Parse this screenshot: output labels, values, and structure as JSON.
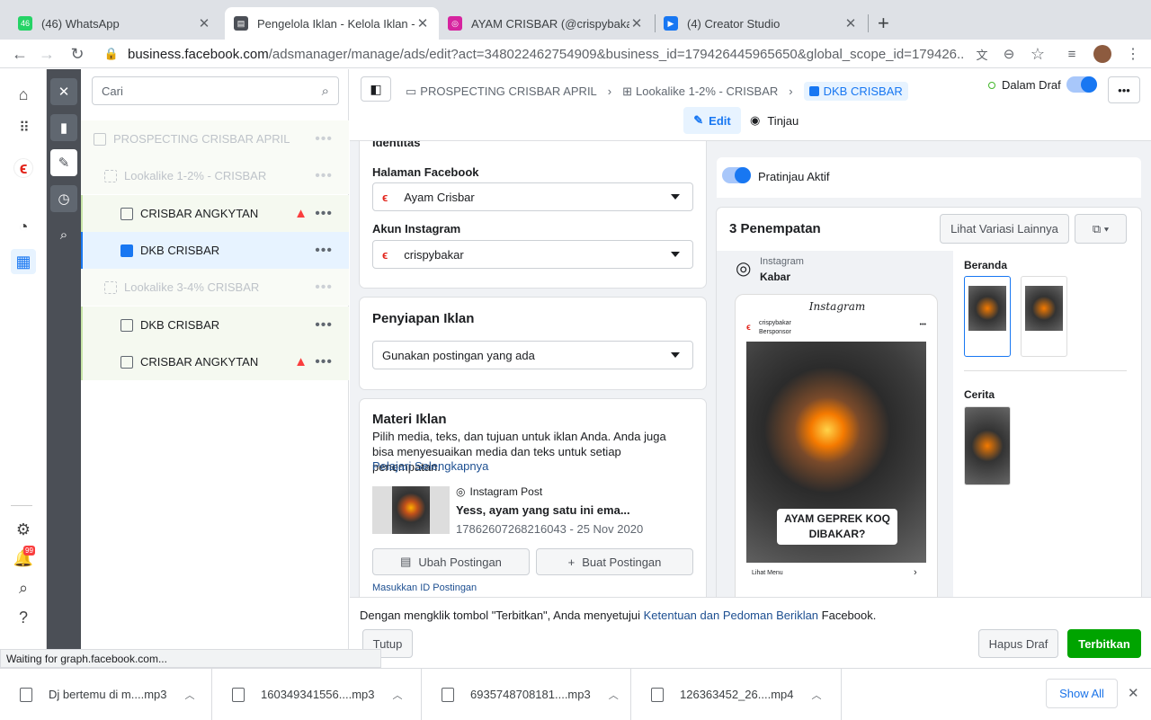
{
  "tabs": [
    {
      "title": "(46) WhatsApp",
      "badge": "46",
      "color": "#25d366"
    },
    {
      "title": "Pengelola Iklan - Kelola Iklan -",
      "color": "#4b4f56"
    },
    {
      "title": "AYAM CRISBAR (@crispybakar)",
      "color": "#d6249f"
    },
    {
      "title": "(4) Creator Studio",
      "color": "#1877f2"
    }
  ],
  "url": {
    "host": "business.facebook.com",
    "path": "/adsmanager/manage/ads/edit?act=348022462754909&business_id=179426445965650&global_scope_id=179426..."
  },
  "rail": {
    "notif_count": "99"
  },
  "tree": {
    "search_placeholder": "Cari",
    "rows": [
      {
        "label": "PROSPECTING CRISBAR APRIL",
        "level": 0,
        "dim": true,
        "warn": false
      },
      {
        "label": "Lookalike 1-2% - CRISBAR",
        "level": 1,
        "dim": true,
        "warn": false
      },
      {
        "label": "CRISBAR ANGKYTAN",
        "level": 2,
        "dim": false,
        "warn": true
      },
      {
        "label": "DKB CRISBAR",
        "level": 2,
        "dim": false,
        "warn": false,
        "selected": true
      },
      {
        "label": "Lookalike 3-4% CRISBAR",
        "level": 1,
        "dim": true,
        "warn": false
      },
      {
        "label": "DKB CRISBAR",
        "level": 2,
        "dim": false,
        "warn": false
      },
      {
        "label": "CRISBAR ANGKYTAN",
        "level": 2,
        "dim": false,
        "warn": true
      }
    ]
  },
  "header": {
    "crumbs": [
      "PROSPECTING CRISBAR APRIL",
      "Lookalike 1-2% - CRISBAR",
      "DKB CRISBAR"
    ],
    "status": "Dalam Draf",
    "edit_label": "Edit",
    "review_label": "Tinjau"
  },
  "identity": {
    "section": "Identitas",
    "fb_label": "Halaman Facebook",
    "fb_value": "Ayam Crisbar",
    "ig_label": "Akun Instagram",
    "ig_value": "crispybakar"
  },
  "setup": {
    "title": "Penyiapan Iklan",
    "value": "Gunakan postingan yang ada"
  },
  "creative": {
    "title": "Materi Iklan",
    "desc": "Pilih media, teks, dan tujuan untuk iklan Anda. Anda juga bisa menyesuaikan media dan teks untuk setiap penempatan.",
    "learn": "Pelajari Selengkapnya",
    "post_type": "Instagram Post",
    "post_text": "Yess, ayam yang satu ini ema...",
    "post_meta": "17862607268216043 - 25 Nov 2020",
    "edit_post": "Ubah Postingan",
    "create_post": "Buat Postingan",
    "enter_id": "Masukkan ID Postingan"
  },
  "preview": {
    "toggle_label": "Pratinjau Aktif",
    "placements": "3 Penempatan",
    "more_variants": "Lihat Variasi Lainnya",
    "platform": "Instagram",
    "surface": "Kabar",
    "ig_header": "Instagram",
    "account": "crispybakar",
    "sponsored": "Bersponsor",
    "overlay": "AYAM GEPREK KOQ DIBAKAR?",
    "cta": "Lihat Menu",
    "feed_label": "Beranda",
    "story_label": "Cerita"
  },
  "footer": {
    "notice_pre": "Dengan mengklik tombol \"Terbitkan\", Anda menyetujui ",
    "notice_link": "Ketentuan dan Pedoman Beriklan",
    "notice_post": " Facebook.",
    "close": "Tutup",
    "delete_draft": "Hapus Draf",
    "publish": "Terbitkan"
  },
  "status_bar": "Waiting for graph.facebook.com...",
  "downloads": {
    "items": [
      "Dj bertemu di m....mp3",
      "160349341556....mp3",
      "6935748708181....mp3",
      "126363452_26....mp4"
    ],
    "show_all": "Show All"
  }
}
